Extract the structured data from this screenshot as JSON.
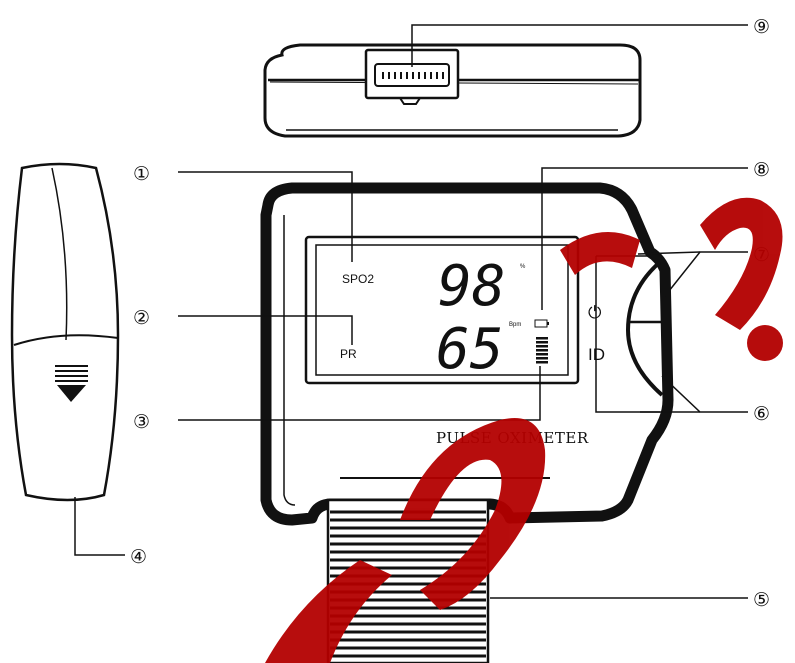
{
  "callouts": {
    "c1": "①",
    "c2": "②",
    "c3": "③",
    "c4": "④",
    "c5": "⑤",
    "c6": "⑥",
    "c7": "⑦",
    "c8": "⑧",
    "c9": "⑨"
  },
  "lcd": {
    "spo2_label": "SPO2",
    "pr_label": "PR",
    "spo2_value": "98",
    "pr_value": "65",
    "percent_unit": "%",
    "bpm_unit": "Bpm"
  },
  "device": {
    "name": "PULSE OXIMETER",
    "power_symbol": "⏻",
    "id_label": "ID"
  },
  "watermark": {
    "color": "#b30000"
  },
  "colors": {
    "line": "#111111",
    "background": "#ffffff"
  }
}
